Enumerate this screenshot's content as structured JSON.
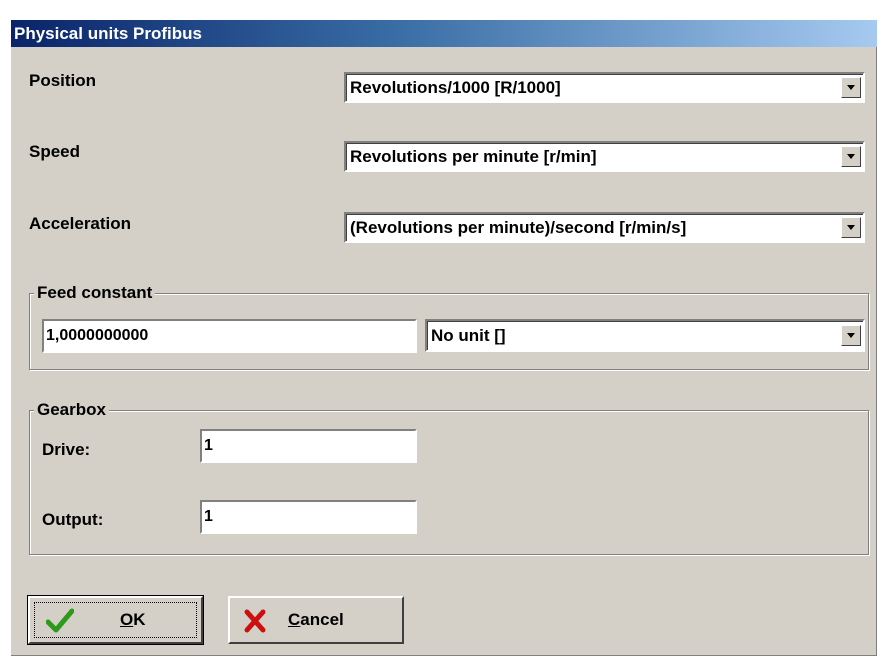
{
  "window": {
    "title": "Physical units Profibus"
  },
  "position": {
    "label": "Position",
    "value": "Revolutions/1000 [R/1000]"
  },
  "speed": {
    "label": "Speed",
    "value": "Revolutions per minute [r/min]"
  },
  "acceleration": {
    "label": "Acceleration",
    "value": "(Revolutions per minute)/second [r/min/s]"
  },
  "feed_constant": {
    "title": "Feed constant",
    "value": "1,0000000000",
    "unit": "No unit []"
  },
  "gearbox": {
    "title": "Gearbox",
    "drive_label": "Drive:",
    "drive_value": "1",
    "output_label": "Output:",
    "output_value": "1"
  },
  "buttons": {
    "ok_mnemonic": "O",
    "ok_rest": "K",
    "cancel_mnemonic": "C",
    "cancel_rest": "ancel"
  },
  "colors": {
    "dialog_bg": "#d4d0c8",
    "title_start": "#0a246a",
    "title_end": "#a6caf0",
    "ok_check": "#2e9a1c",
    "cancel_x": "#cc1010"
  },
  "icons": {
    "ok": "checkmark-icon",
    "cancel": "x-icon",
    "dropdown": "dropdown-arrow-icon"
  }
}
